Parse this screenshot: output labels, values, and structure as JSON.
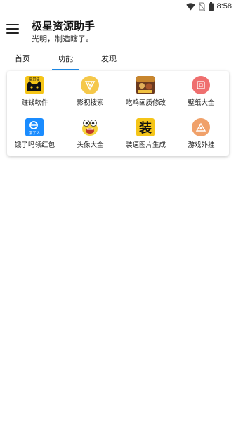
{
  "status_bar": {
    "time": "8:58",
    "icons": [
      "wifi-icon",
      "no-sim-icon",
      "battery-icon"
    ]
  },
  "header": {
    "title": "极星资源助手",
    "subtitle": "光明，制造瞎子。",
    "menu_icon": "hamburger-menu-icon"
  },
  "tabs": [
    {
      "label": "首页",
      "active": false
    },
    {
      "label": "功能",
      "active": true
    },
    {
      "label": "发现",
      "active": false
    }
  ],
  "features": [
    {
      "label": "赚钱软件",
      "icon": "cat-money-app-icon",
      "icon_text": "悬赏猫"
    },
    {
      "label": "影视搜索",
      "icon": "video-search-icon"
    },
    {
      "label": "吃鸡画质修改",
      "icon": "game-graphics-icon"
    },
    {
      "label": "壁纸大全",
      "icon": "wallpaper-icon"
    },
    {
      "label": "饿了吗领红包",
      "icon": "eleme-icon",
      "icon_text": "饿了么"
    },
    {
      "label": "头像大全",
      "icon": "avatar-face-icon"
    },
    {
      "label": "装逼图片生成",
      "icon": "zhuang-text-icon",
      "icon_text": "装"
    },
    {
      "label": "游戏外挂",
      "icon": "game-cheat-icon"
    }
  ],
  "colors": {
    "accent": "#1e88e5",
    "yellow": "#f5c518",
    "pink": "#ef6f6f",
    "orange": "#f0a16a",
    "eleme_blue": "#1a8cff"
  }
}
